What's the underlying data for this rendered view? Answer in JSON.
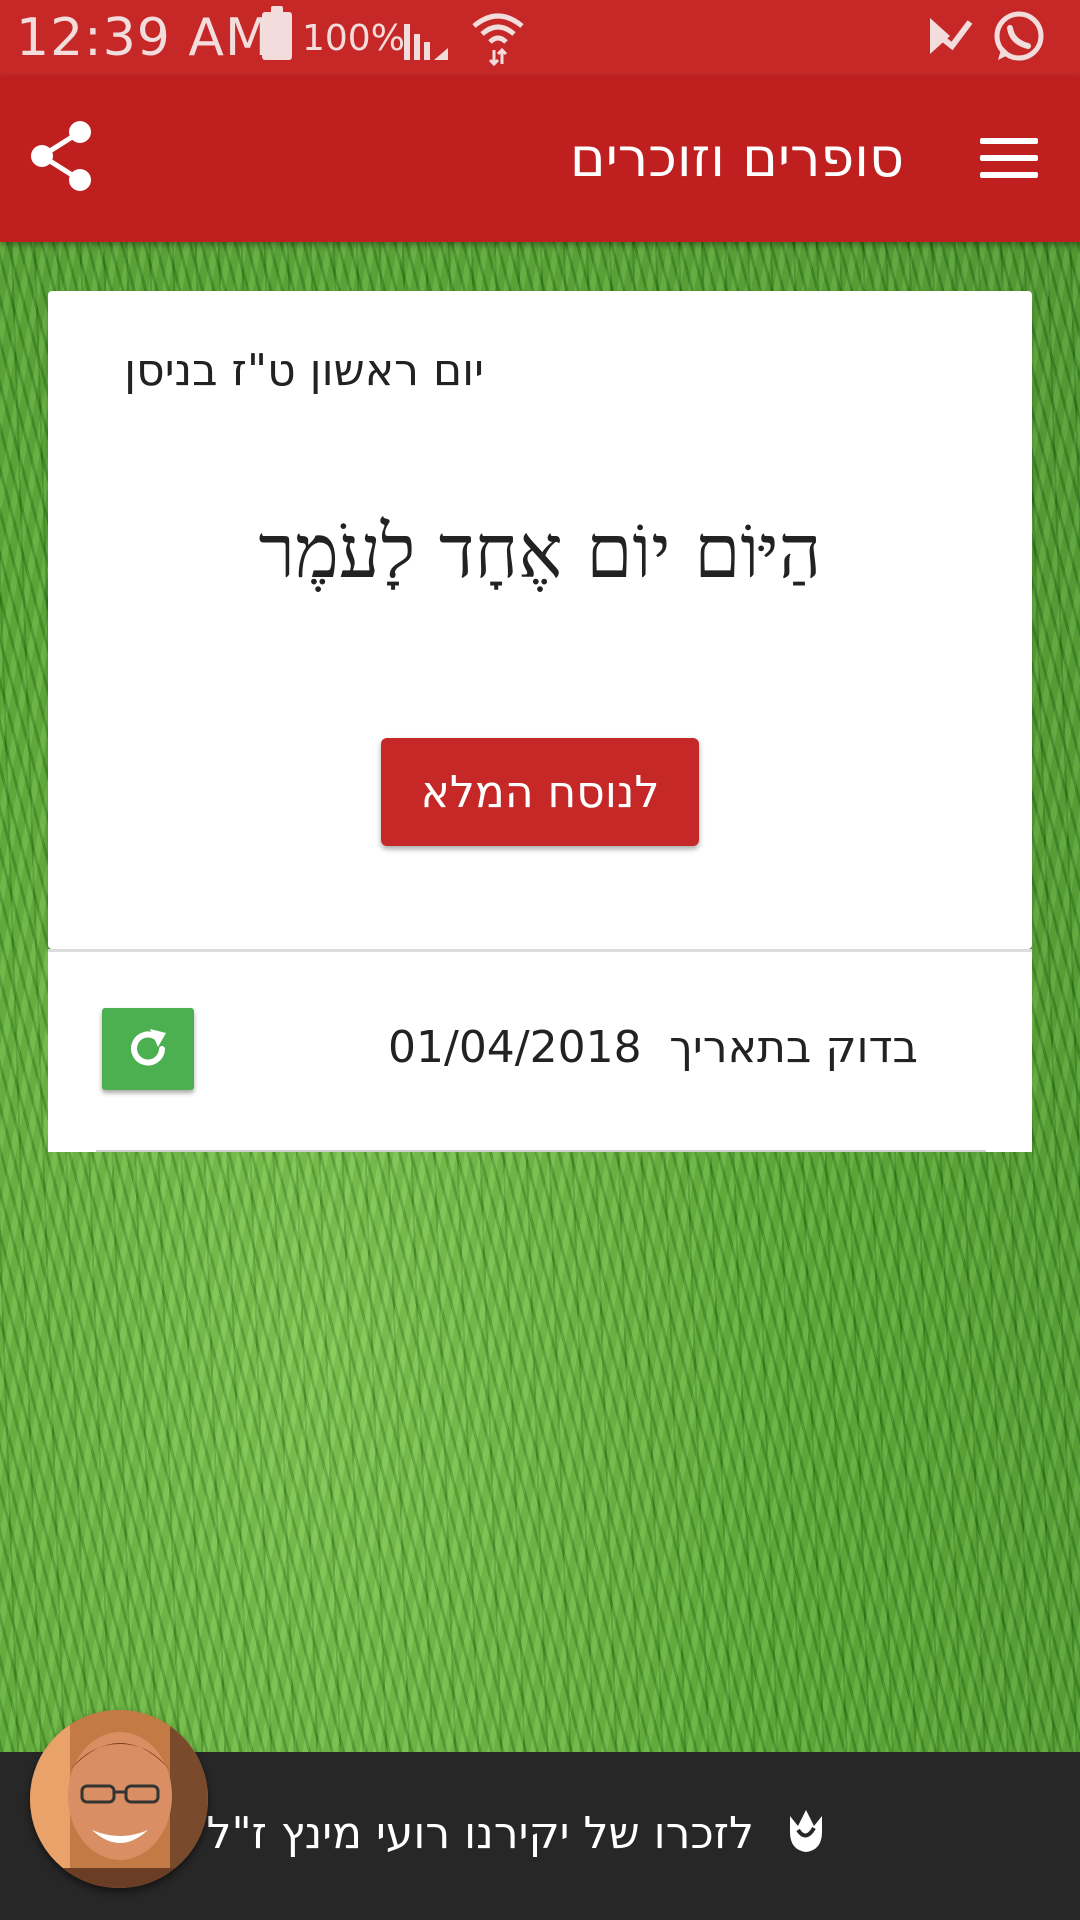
{
  "status_bar": {
    "time": "12:39 AM",
    "battery": "100%"
  },
  "app_bar": {
    "title": "סופרים וזוכרים",
    "share_icon": "share-icon",
    "menu_icon": "hamburger-menu-icon"
  },
  "card": {
    "hebrew_date": "יום ראשון ט\"ז בניסן",
    "omer_count": "הַיּוֹם יוֹם אֶחָד לָעֹמֶר",
    "full_text_button": "לנוסח המלא"
  },
  "date_check": {
    "label": "בדוק בתאריך",
    "date": "01/04/2018",
    "refresh_icon": "refresh-icon"
  },
  "footer": {
    "memorial_text": "לזכרו של יקירנו רועי מינץ ז\"ל",
    "flower_icon": "flower-icon"
  },
  "colors": {
    "primary": "#c62828",
    "refresh_green": "#4caf50",
    "footer_bg": "#272727"
  }
}
